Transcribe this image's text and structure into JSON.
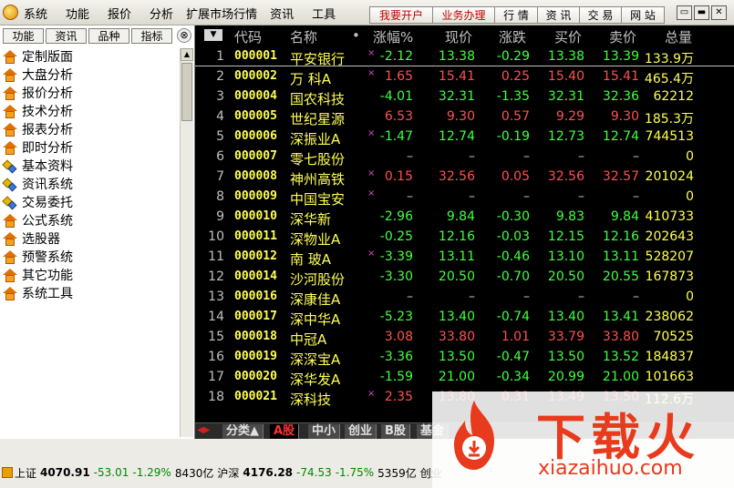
{
  "menubar": {
    "items": [
      "系统",
      "功能",
      "报价",
      "分析",
      "扩展市场行情",
      "资讯",
      "工具"
    ],
    "buttons": [
      "我要开户",
      "业务办理",
      "行 情",
      "资 讯",
      "交 易",
      "网 站"
    ],
    "window_controls": [
      "▭",
      "▬",
      "✕"
    ]
  },
  "sidebar": {
    "tabs": [
      "功能",
      "资讯",
      "品种",
      "指标"
    ],
    "close": "⊗",
    "items": [
      {
        "label": "定制版面",
        "icon": "house-icon"
      },
      {
        "label": "大盘分析",
        "icon": "house-icon"
      },
      {
        "label": "报价分析",
        "icon": "house-icon"
      },
      {
        "label": "技术分析",
        "icon": "house-icon"
      },
      {
        "label": "报表分析",
        "icon": "house-icon"
      },
      {
        "label": "即时分析",
        "icon": "house-icon"
      },
      {
        "label": "基本资料",
        "icon": "puzzle-icon"
      },
      {
        "label": "资讯系统",
        "icon": "puzzle-icon"
      },
      {
        "label": "交易委托",
        "icon": "puzzle-icon"
      },
      {
        "label": "公式系统",
        "icon": "house-icon"
      },
      {
        "label": "选股器",
        "icon": "house-icon"
      },
      {
        "label": "预警系统",
        "icon": "house-icon"
      },
      {
        "label": "其它功能",
        "icon": "house-icon"
      },
      {
        "label": "系统工具",
        "icon": "house-icon"
      }
    ]
  },
  "table": {
    "sort_label": "▼",
    "headers": {
      "code": "代码",
      "name": "名称",
      "dot": "•",
      "pct": "涨幅%",
      "price": "现价",
      "chg": "涨跌",
      "buy": "买价",
      "sell": "卖价",
      "vol": "总量"
    },
    "rows": [
      {
        "idx": "1",
        "code": "000001",
        "name": "平安银行",
        "mark": "×",
        "pct": "-2.12",
        "price": "13.38",
        "chg": "-0.29",
        "buy": "13.38",
        "sell": "13.39",
        "vol": "133.9万",
        "dir": "down"
      },
      {
        "idx": "2",
        "code": "000002",
        "name": "万 科A",
        "mark": "×",
        "pct": "1.65",
        "price": "15.41",
        "chg": "0.25",
        "buy": "15.40",
        "sell": "15.41",
        "vol": "465.4万",
        "dir": "up"
      },
      {
        "idx": "3",
        "code": "000004",
        "name": "国农科技",
        "mark": "",
        "pct": "-4.01",
        "price": "32.31",
        "chg": "-1.35",
        "buy": "32.31",
        "sell": "32.36",
        "vol": "62212",
        "dir": "down"
      },
      {
        "idx": "4",
        "code": "000005",
        "name": "世纪星源",
        "mark": "",
        "pct": "6.53",
        "price": "9.30",
        "chg": "0.57",
        "buy": "9.29",
        "sell": "9.30",
        "vol": "185.3万",
        "dir": "up"
      },
      {
        "idx": "5",
        "code": "000006",
        "name": "深振业A",
        "mark": "×",
        "pct": "-1.47",
        "price": "12.74",
        "chg": "-0.19",
        "buy": "12.73",
        "sell": "12.74",
        "vol": "744513",
        "dir": "down"
      },
      {
        "idx": "6",
        "code": "000007",
        "name": "零七股份",
        "mark": "",
        "pct": "–",
        "price": "–",
        "chg": "–",
        "buy": "–",
        "sell": "–",
        "vol": "0",
        "dir": "flat"
      },
      {
        "idx": "7",
        "code": "000008",
        "name": "神州高铁",
        "mark": "×",
        "pct": "0.15",
        "price": "32.56",
        "chg": "0.05",
        "buy": "32.56",
        "sell": "32.57",
        "vol": "201024",
        "dir": "up"
      },
      {
        "idx": "8",
        "code": "000009",
        "name": "中国宝安",
        "mark": "×",
        "pct": "–",
        "price": "–",
        "chg": "–",
        "buy": "–",
        "sell": "–",
        "vol": "0",
        "dir": "flat"
      },
      {
        "idx": "9",
        "code": "000010",
        "name": "深华新",
        "mark": "",
        "pct": "-2.96",
        "price": "9.84",
        "chg": "-0.30",
        "buy": "9.83",
        "sell": "9.84",
        "vol": "410733",
        "dir": "down"
      },
      {
        "idx": "10",
        "code": "000011",
        "name": "深物业A",
        "mark": "",
        "pct": "-0.25",
        "price": "12.16",
        "chg": "-0.03",
        "buy": "12.15",
        "sell": "12.16",
        "vol": "202643",
        "dir": "down"
      },
      {
        "idx": "11",
        "code": "000012",
        "name": "南 玻A",
        "mark": "×",
        "pct": "-3.39",
        "price": "13.11",
        "chg": "-0.46",
        "buy": "13.10",
        "sell": "13.11",
        "vol": "528207",
        "dir": "down"
      },
      {
        "idx": "12",
        "code": "000014",
        "name": "沙河股份",
        "mark": "",
        "pct": "-3.30",
        "price": "20.50",
        "chg": "-0.70",
        "buy": "20.50",
        "sell": "20.55",
        "vol": "167873",
        "dir": "down"
      },
      {
        "idx": "13",
        "code": "000016",
        "name": "深康佳A",
        "mark": "",
        "pct": "–",
        "price": "–",
        "chg": "–",
        "buy": "–",
        "sell": "–",
        "vol": "0",
        "dir": "flat"
      },
      {
        "idx": "14",
        "code": "000017",
        "name": "深中华A",
        "mark": "",
        "pct": "-5.23",
        "price": "13.40",
        "chg": "-0.74",
        "buy": "13.40",
        "sell": "13.41",
        "vol": "238062",
        "dir": "down"
      },
      {
        "idx": "15",
        "code": "000018",
        "name": "中冠A",
        "mark": "",
        "pct": "3.08",
        "price": "33.80",
        "chg": "1.01",
        "buy": "33.79",
        "sell": "33.80",
        "vol": "70525",
        "dir": "up"
      },
      {
        "idx": "16",
        "code": "000019",
        "name": "深深宝A",
        "mark": "",
        "pct": "-3.36",
        "price": "13.50",
        "chg": "-0.47",
        "buy": "13.50",
        "sell": "13.52",
        "vol": "184837",
        "dir": "down"
      },
      {
        "idx": "17",
        "code": "000020",
        "name": "深华发A",
        "mark": "",
        "pct": "-1.59",
        "price": "21.00",
        "chg": "-0.34",
        "buy": "20.99",
        "sell": "21.00",
        "vol": "101663",
        "dir": "down"
      },
      {
        "idx": "18",
        "code": "000021",
        "name": "深科技",
        "mark": "×",
        "pct": "2.35",
        "price": "13.80",
        "chg": "0.31",
        "buy": "13.49",
        "sell": "13.50",
        "vol": "112.6万",
        "dir": "up"
      }
    ]
  },
  "board_tabs": [
    "分类▲",
    "A股",
    "中小",
    "创业",
    "B股",
    "基金"
  ],
  "board_nav": "◀▶",
  "statusbar": {
    "sh_label": "上证",
    "sh_value": "4070.91",
    "sh_chg": "-53.01",
    "sh_pct": "-1.29%",
    "sh_amount": "8430亿",
    "sz_label": "沪深",
    "sz_value": "4176.28",
    "sz_chg": "-74.53",
    "sz_pct": "-1.75%",
    "sz_amount": "5359亿",
    "cy_label": "创业"
  },
  "watermark": {
    "text": "下载火",
    "url": "xiazaihuo.com"
  }
}
